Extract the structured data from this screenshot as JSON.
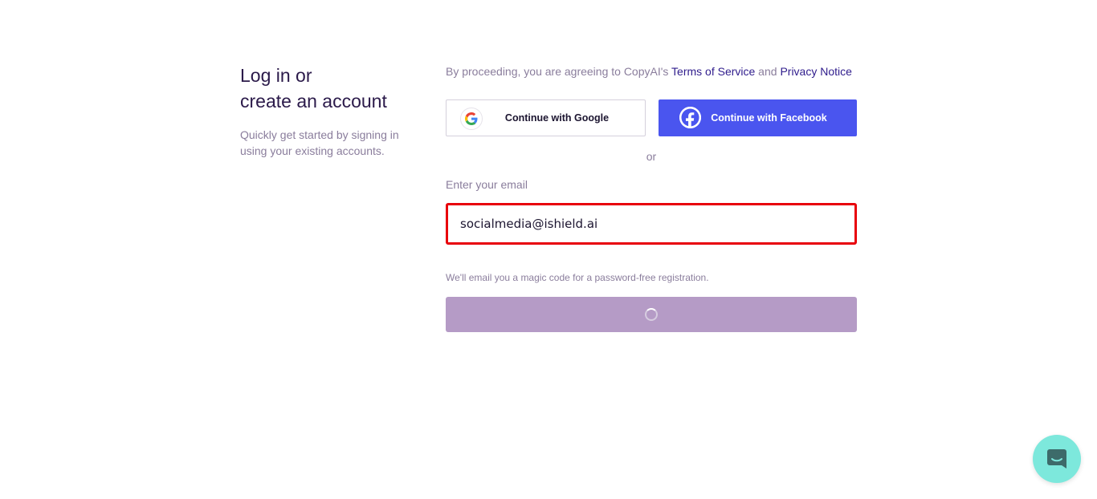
{
  "heading": {
    "line1": "Log in or",
    "line2": "create an account",
    "subtitle": "Quickly get started by signing in using your existing accounts."
  },
  "terms": {
    "prefix": "By proceeding, you are agreeing to CopyAI's ",
    "tos_link": "Terms of Service",
    "and": " and ",
    "privacy_link": "Privacy Notice"
  },
  "social": {
    "google_label": "Continue with Google",
    "facebook_label": "Continue with Facebook",
    "google_icon": "google-icon",
    "facebook_icon": "facebook-icon"
  },
  "divider": "or",
  "email": {
    "label": "Enter your email",
    "value": "socialmedia@ishield.ai",
    "hint": "We'll email you a magic code for a password-free registration."
  },
  "submit": {
    "state": "loading"
  },
  "colors": {
    "accent": "#4a55ef",
    "error_border": "#e8000b",
    "submit_disabled": "#b59bc6",
    "chat_bubble": "#7de8dc"
  }
}
